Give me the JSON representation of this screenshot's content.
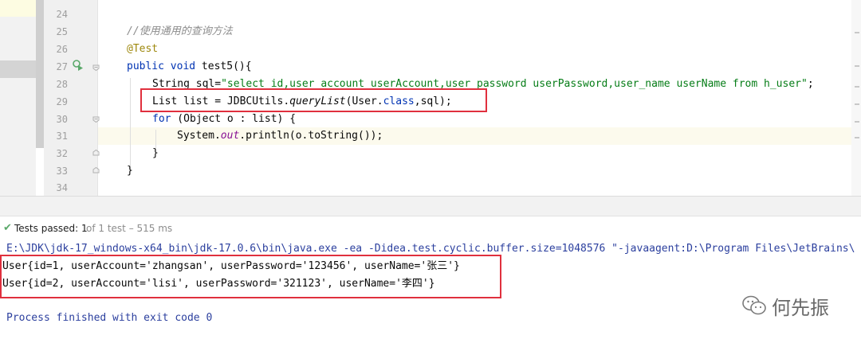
{
  "editor": {
    "line_numbers": [
      "24",
      "25",
      "26",
      "27",
      "28",
      "29",
      "30",
      "31",
      "32",
      "33",
      "34"
    ],
    "lines": {
      "l25": "//使用通用的查询方法",
      "l26": "@Test",
      "l27_kw1": "public",
      "l27_kw2": "void",
      "l27_rest": " test5(){",
      "l28_type": "String sql=",
      "l28_str": "\"select id,user_account userAccount,user_password userPassword,user_name userName from h_user\"",
      "l28_end": ";",
      "l29_a": "List list = JDBCUtils.",
      "l29_method": "queryList",
      "l29_b": "(User.",
      "l29_kw": "class",
      "l29_c": ",sql);",
      "l30_kw": "for",
      "l30_rest": " (Object o : list) {",
      "l31_a": "System.",
      "l31_field": "out",
      "l31_b": ".println(o.toString());",
      "l32": "}",
      "l33": "}"
    }
  },
  "status": {
    "label": "Tests passed: 1",
    "count": "of 1 test – 515 ms"
  },
  "console": {
    "cmd": "E:\\JDK\\jdk-17_windows-x64_bin\\jdk-17.0.6\\bin\\java.exe -ea -Didea.test.cyclic.buffer.size=1048576 \"-javaagent:D:\\Program Files\\JetBrains\\",
    "row1": "User{id=1, userAccount='zhangsan', userPassword='123456', userName='张三'}",
    "row2": "User{id=2, userAccount='lisi', userPassword='321123', userName='李四'}",
    "exit": "Process finished with exit code 0"
  },
  "watermark": {
    "text": "何先振"
  },
  "icons": {
    "run": "run-test-icon",
    "check": "check-icon",
    "wechat": "wechat-icon"
  },
  "colors": {
    "highlight_box": "#e0303e",
    "keyword": "#0033b3",
    "string": "#067d17",
    "pass": "#59a869"
  }
}
